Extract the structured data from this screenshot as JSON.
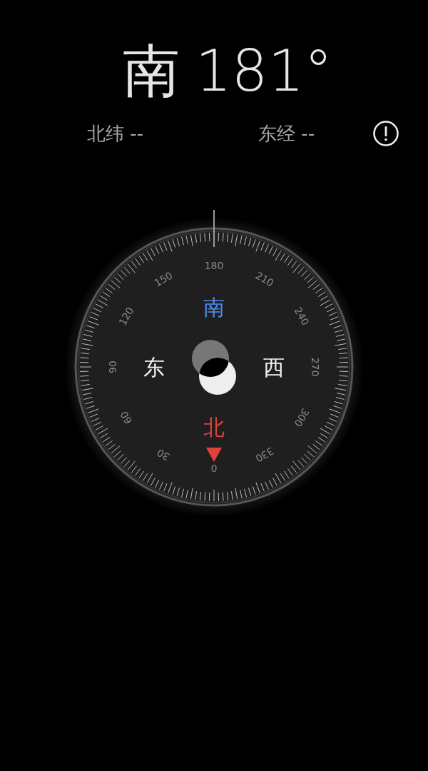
{
  "heading": {
    "direction": "南",
    "degrees": "181°"
  },
  "coordinates": [
    {
      "label": "北纬 --"
    },
    {
      "label": "东经 --"
    }
  ],
  "dial": {
    "numbers": [
      "0",
      "30",
      "60",
      "90",
      "120",
      "150",
      "180",
      "210",
      "240",
      "270",
      "300",
      "330"
    ],
    "cardinals": [
      {
        "label": "北",
        "color": "#e0413a"
      },
      {
        "label": "东",
        "color": "#f2f2f2"
      },
      {
        "label": "南",
        "color": "#4f8ef0"
      },
      {
        "label": "西",
        "color": "#f2f2f2"
      }
    ]
  }
}
